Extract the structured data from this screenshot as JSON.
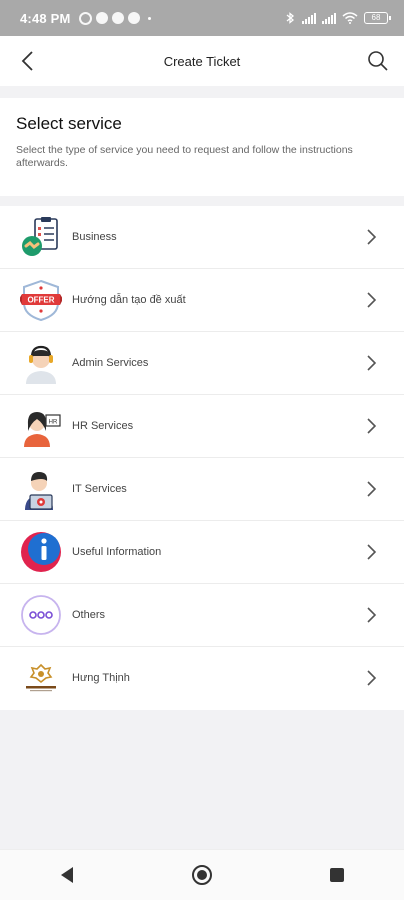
{
  "status_bar": {
    "time": "4:48 PM",
    "battery": "68"
  },
  "header": {
    "title": "Create Ticket",
    "back_icon": "back-arrow-icon",
    "search_icon": "search-icon"
  },
  "intro": {
    "title": "Select service",
    "description": "Select the type of service you need to request and follow the instructions afterwards."
  },
  "services": [
    {
      "label": "Business",
      "icon": "business-clipboard-icon"
    },
    {
      "label": "Hướng dẫn tạo đề xuất",
      "icon": "offer-badge-icon"
    },
    {
      "label": "Admin Services",
      "icon": "admin-headset-icon"
    },
    {
      "label": "HR Services",
      "icon": "hr-person-icon"
    },
    {
      "label": "IT Services",
      "icon": "it-person-icon"
    },
    {
      "label": "Useful Information",
      "icon": "info-icon"
    },
    {
      "label": "Others",
      "icon": "others-dots-icon"
    },
    {
      "label": "Hưng Thịnh",
      "icon": "hung-thinh-logo"
    }
  ],
  "colors": {
    "status_bar": "#a9a9a9",
    "page_bg": "#f2f2f4",
    "info_red": "#e0234e",
    "info_blue": "#1f6fd1",
    "others_purple": "#7a4fd6"
  }
}
